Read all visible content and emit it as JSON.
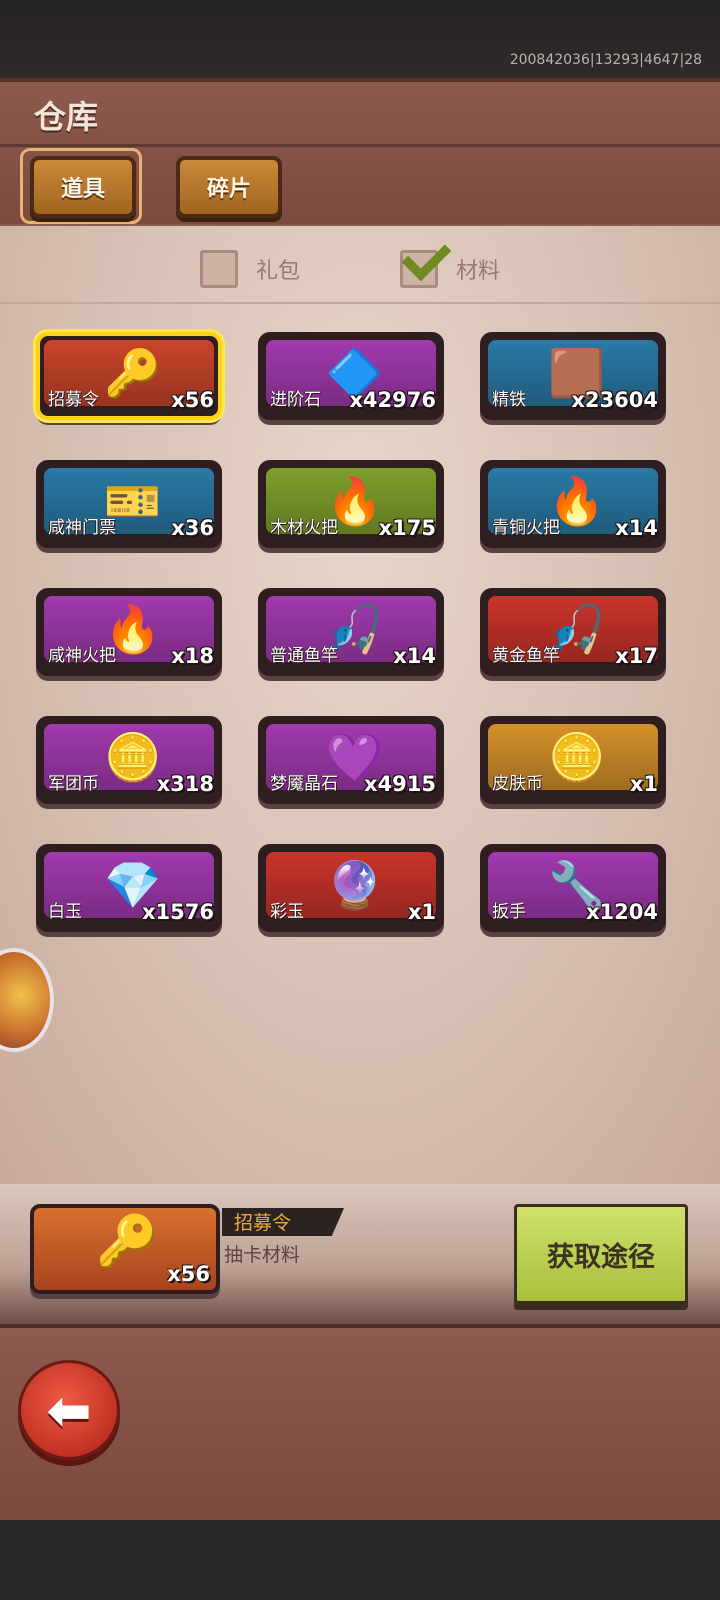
{
  "status": {
    "build_info": "200842036|13293|4647|28"
  },
  "header": {
    "title": "仓库",
    "tabs": [
      {
        "label": "道具",
        "active": true
      },
      {
        "label": "碎片",
        "active": false
      }
    ]
  },
  "filters": [
    {
      "label": "礼包",
      "checked": false
    },
    {
      "label": "材料",
      "checked": true
    }
  ],
  "items": [
    {
      "name": "招募令",
      "count": "x56",
      "icon": "recruit-token-icon",
      "glyph": "🔑",
      "color": "#c9452b",
      "selected": true
    },
    {
      "name": "进阶石",
      "count": "x42976",
      "icon": "advance-stone-icon",
      "glyph": "🔷",
      "color": "#a23ab0",
      "selected": false
    },
    {
      "name": "精铁",
      "count": "x23604",
      "icon": "refined-iron-icon",
      "glyph": "🟫",
      "color": "#2a7aa6",
      "selected": false
    },
    {
      "name": "咸神门票",
      "count": "x36",
      "icon": "ticket-icon",
      "glyph": "🎫",
      "color": "#2a7aa6",
      "selected": false
    },
    {
      "name": "木材火把",
      "count": "x175",
      "icon": "wood-torch-icon",
      "glyph": "🔥",
      "color": "#7fa02c",
      "selected": false
    },
    {
      "name": "青铜火把",
      "count": "x14",
      "icon": "bronze-torch-icon",
      "glyph": "🔥",
      "color": "#2a7aa6",
      "selected": false
    },
    {
      "name": "咸神火把",
      "count": "x18",
      "icon": "god-torch-icon",
      "glyph": "🔥",
      "color": "#a23ab0",
      "selected": false
    },
    {
      "name": "普通鱼竿",
      "count": "x14",
      "icon": "fishing-rod-icon",
      "glyph": "🎣",
      "color": "#a23ab0",
      "selected": false
    },
    {
      "name": "黄金鱼竿",
      "count": "x17",
      "icon": "golden-rod-icon",
      "glyph": "🎣",
      "color": "#c9342b",
      "selected": false
    },
    {
      "name": "军团币",
      "count": "x318",
      "icon": "legion-coin-icon",
      "glyph": "🪙",
      "color": "#a23ab0",
      "selected": false
    },
    {
      "name": "梦魇晶石",
      "count": "x4915",
      "icon": "nightmare-crystal-icon",
      "glyph": "💜",
      "color": "#a23ab0",
      "selected": false
    },
    {
      "name": "皮肤币",
      "count": "x1",
      "icon": "skin-coin-icon",
      "glyph": "🪙",
      "color": "#d4902a",
      "selected": false
    },
    {
      "name": "白玉",
      "count": "x1576",
      "icon": "white-jade-icon",
      "glyph": "💎",
      "color": "#a23ab0",
      "selected": false
    },
    {
      "name": "彩玉",
      "count": "x1",
      "icon": "rainbow-jade-icon",
      "glyph": "🔮",
      "color": "#c9342b",
      "selected": false
    },
    {
      "name": "扳手",
      "count": "x1204",
      "icon": "wrench-icon",
      "glyph": "🔧",
      "color": "#a23ab0",
      "selected": false
    }
  ],
  "selected": {
    "name": "招募令",
    "desc": "抽卡材料",
    "count": "x56",
    "glyph": "🔑"
  },
  "actions": {
    "obtain_label": "获取途径",
    "back_glyph": "⬅"
  }
}
